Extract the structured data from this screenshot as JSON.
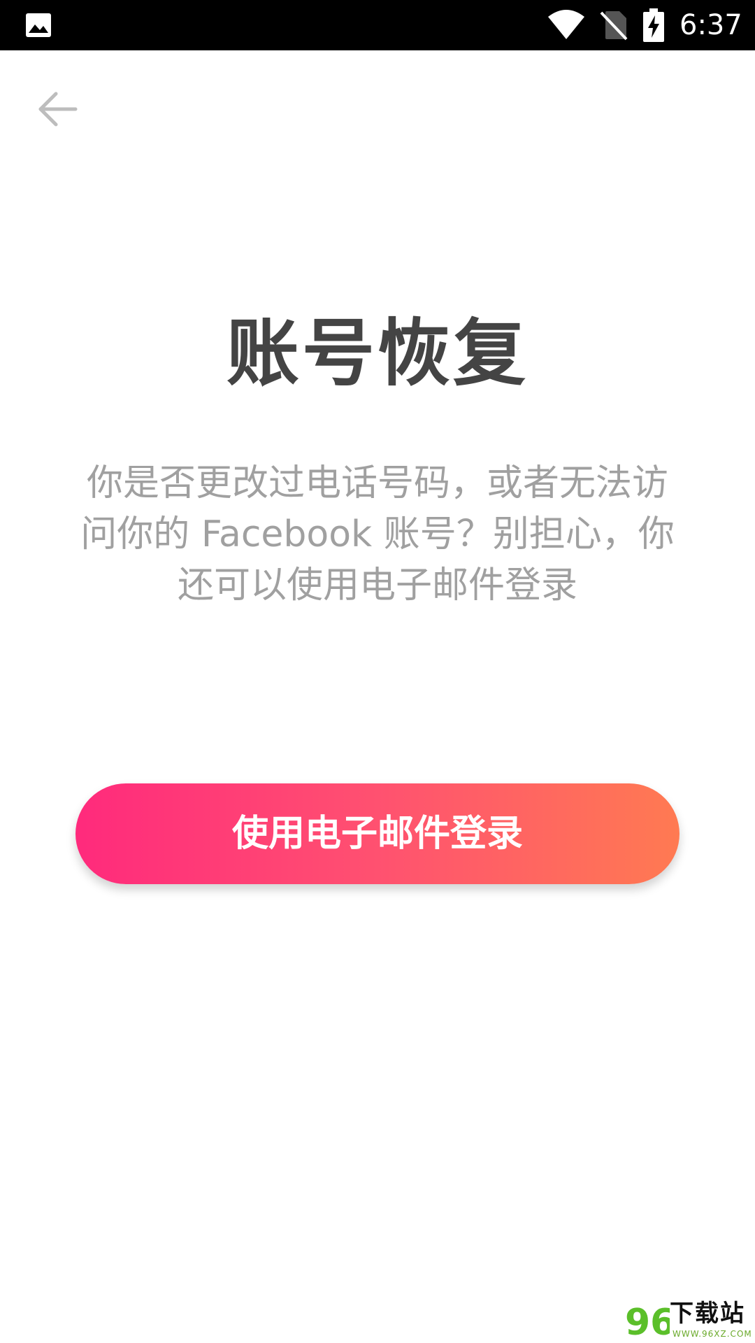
{
  "status_bar": {
    "time": "6:37",
    "icons": [
      "gallery-icon",
      "wifi-icon",
      "no-sim-icon",
      "battery-charging-icon"
    ]
  },
  "header": {
    "back_icon": "arrow-left-icon"
  },
  "main": {
    "title": "账号恢复",
    "description": "你是否更改过电话号码，或者无法访问你的 Facebook 账号？别担心，你还可以使用电子邮件登录",
    "button_label": "使用电子邮件登录"
  },
  "watermark": {
    "logo_text": "96",
    "text": "下载站",
    "url": "WWW.96XZ.COM"
  },
  "colors": {
    "button_gradient_start": "#ff2a7c",
    "button_gradient_end": "#ff7a52",
    "title": "#444444",
    "description": "#a0a0a0"
  }
}
